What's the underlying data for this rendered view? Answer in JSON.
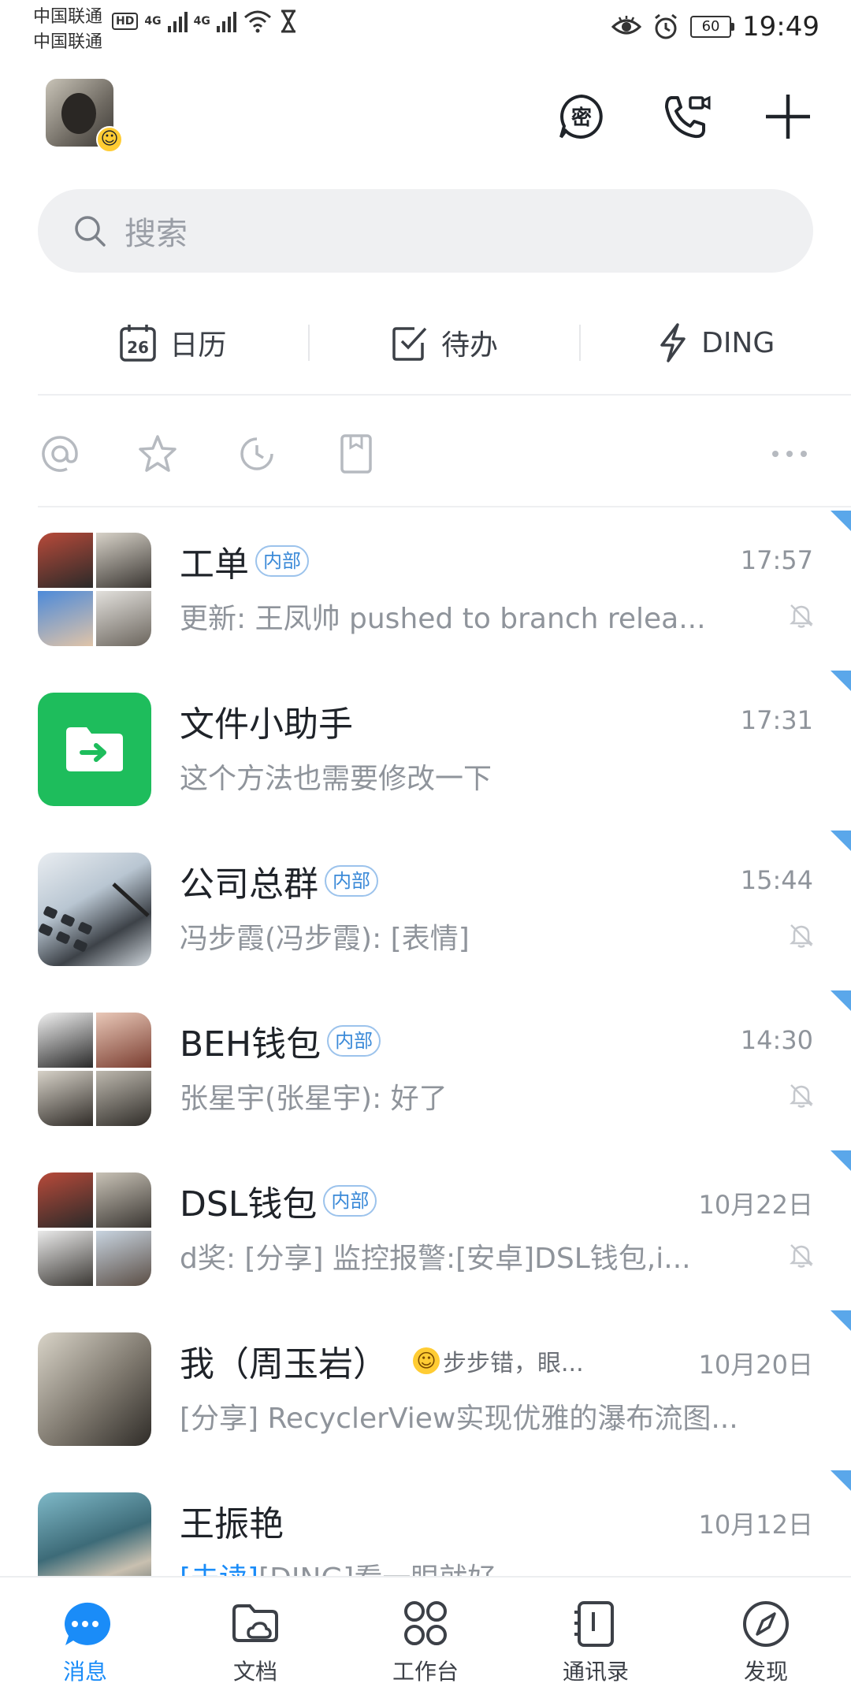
{
  "status_bar": {
    "carrier1": "中国联通",
    "carrier2": "中国联通",
    "hd": "HD",
    "sig1": "4G",
    "sig2": "4G",
    "battery": "60",
    "time": "19:49"
  },
  "search": {
    "placeholder": "搜索"
  },
  "quick_actions": [
    {
      "label": "日历",
      "icon": "calendar-icon",
      "day": "26"
    },
    {
      "label": "待办",
      "icon": "checkbox-icon"
    },
    {
      "label": "DING",
      "icon": "lightning-icon"
    }
  ],
  "filters": [
    "at-icon",
    "star-icon",
    "clock-icon",
    "bookmark-icon",
    "more-icon"
  ],
  "conversations": [
    {
      "title": "工单",
      "tag": "内部",
      "time": "17:57",
      "preview": "更新: 王凤帅 pushed to branch relea...",
      "muted": true
    },
    {
      "title": "文件小助手",
      "tag": "",
      "time": "17:31",
      "preview": "这个方法也需要修改一下",
      "muted": false
    },
    {
      "title": "公司总群",
      "tag": "内部",
      "time": "15:44",
      "preview": "冯步霞(冯步霞): [表情]",
      "muted": true
    },
    {
      "title": "BEH钱包",
      "tag": "内部",
      "time": "14:30",
      "preview": "张星宇(张星宇): 好了",
      "muted": true
    },
    {
      "title": "DSL钱包",
      "tag": "内部",
      "time": "10月22日",
      "preview": "d奖: [分享] 监控报警:[安卓]DSL钱包,i...",
      "muted": true
    },
    {
      "title": "我（周玉岩）",
      "tag": "",
      "status": "步步错，眼...",
      "time": "10月20日",
      "preview": "[分享] RecyclerView实现优雅的瀑布流图...",
      "muted": false
    },
    {
      "title": "王振艳",
      "tag": "",
      "time": "10月12日",
      "preview_tag": "[未读]",
      "preview": "[DING]看一眼就好",
      "muted": false
    }
  ],
  "bottom_nav": [
    {
      "label": "消息",
      "active": true
    },
    {
      "label": "文档",
      "active": false
    },
    {
      "label": "工作台",
      "active": false
    },
    {
      "label": "通讯录",
      "active": false
    },
    {
      "label": "发现",
      "active": false
    }
  ],
  "colors": {
    "accent": "#1a8cf8",
    "file_assistant_green": "#1ebd5c",
    "corner_marker": "#5aa7ea"
  }
}
